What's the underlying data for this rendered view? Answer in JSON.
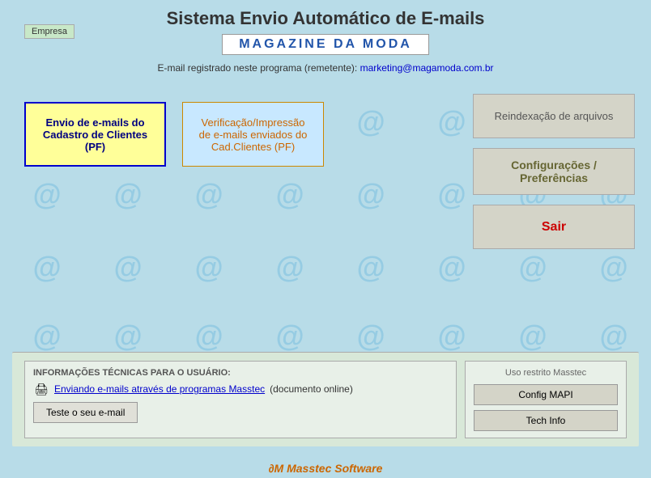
{
  "header": {
    "title": "Sistema Envio Automático de E-mails",
    "empresa_btn": "Empresa",
    "company_name": "MAGAZINE  DA  MODA",
    "email_label": "E-mail registrado neste programa (remetente):",
    "email_address": "marketing@magamoda.com.br"
  },
  "buttons": {
    "send_emails": "Envio de e-mails do Cadastro de Clientes (PF)",
    "verify_emails": "Verificação/Impressão de e-mails enviados do Cad.Clientes (PF)",
    "reindex": "Reindexação de arquivos",
    "config": "Configurações / Preferências",
    "sair": "Sair"
  },
  "bottom": {
    "info_title": "INFORMAÇÕES TÉCNICAS PARA O USUÁRIO:",
    "doc_link": "Enviando e-mails através de programas Masstec",
    "doc_note": "(documento online)",
    "test_btn": "Teste o seu e-mail",
    "restricted_label": "Uso restrito Masstec",
    "config_mapi_btn": "Config MAPI",
    "tech_info_btn": "Tech Info"
  },
  "footer": {
    "logo_symbol": "∂M",
    "logo_text": "Masstec Software"
  }
}
